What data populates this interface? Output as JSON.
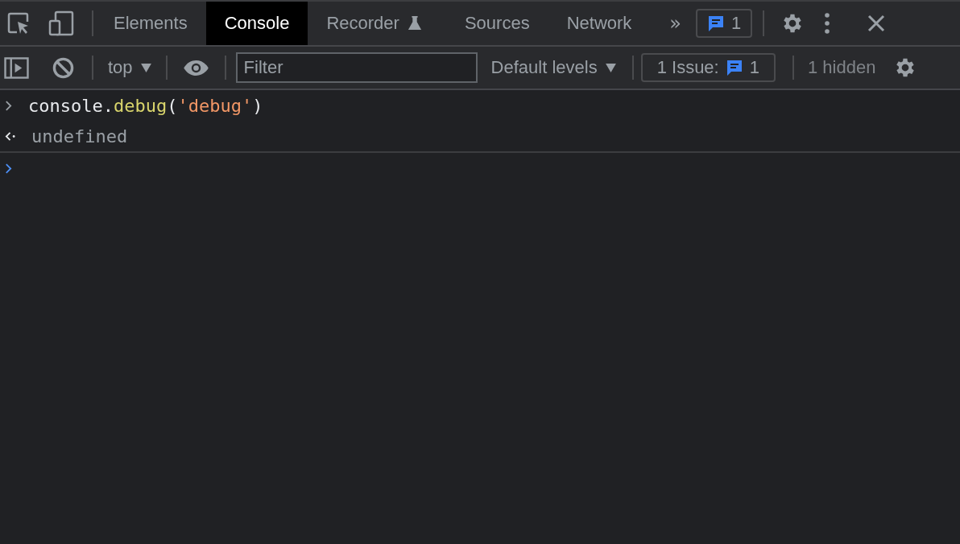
{
  "tabs": [
    {
      "label": "Elements",
      "selected": false,
      "experimental": false
    },
    {
      "label": "Console",
      "selected": true,
      "experimental": false
    },
    {
      "label": "Recorder",
      "selected": false,
      "experimental": true
    },
    {
      "label": "Sources",
      "selected": false,
      "experimental": false
    },
    {
      "label": "Network",
      "selected": false,
      "experimental": false
    }
  ],
  "more_tabs": "»",
  "issues_badge": {
    "count": "1"
  },
  "toolbar": {
    "context": "top",
    "filter": {
      "placeholder": "Filter"
    },
    "levels": "Default levels",
    "issues": {
      "label": "1 Issue:",
      "count": "1"
    },
    "hidden": "1 hidden"
  },
  "console": {
    "entries": [
      {
        "kind": "input",
        "tokens": [
          {
            "kind": "plain",
            "text": "console."
          },
          {
            "kind": "method",
            "text": "debug"
          },
          {
            "kind": "plain",
            "text": "("
          },
          {
            "kind": "string",
            "text": "'debug'"
          },
          {
            "kind": "plain",
            "text": ")"
          }
        ]
      },
      {
        "kind": "result",
        "text": "undefined"
      }
    ]
  }
}
